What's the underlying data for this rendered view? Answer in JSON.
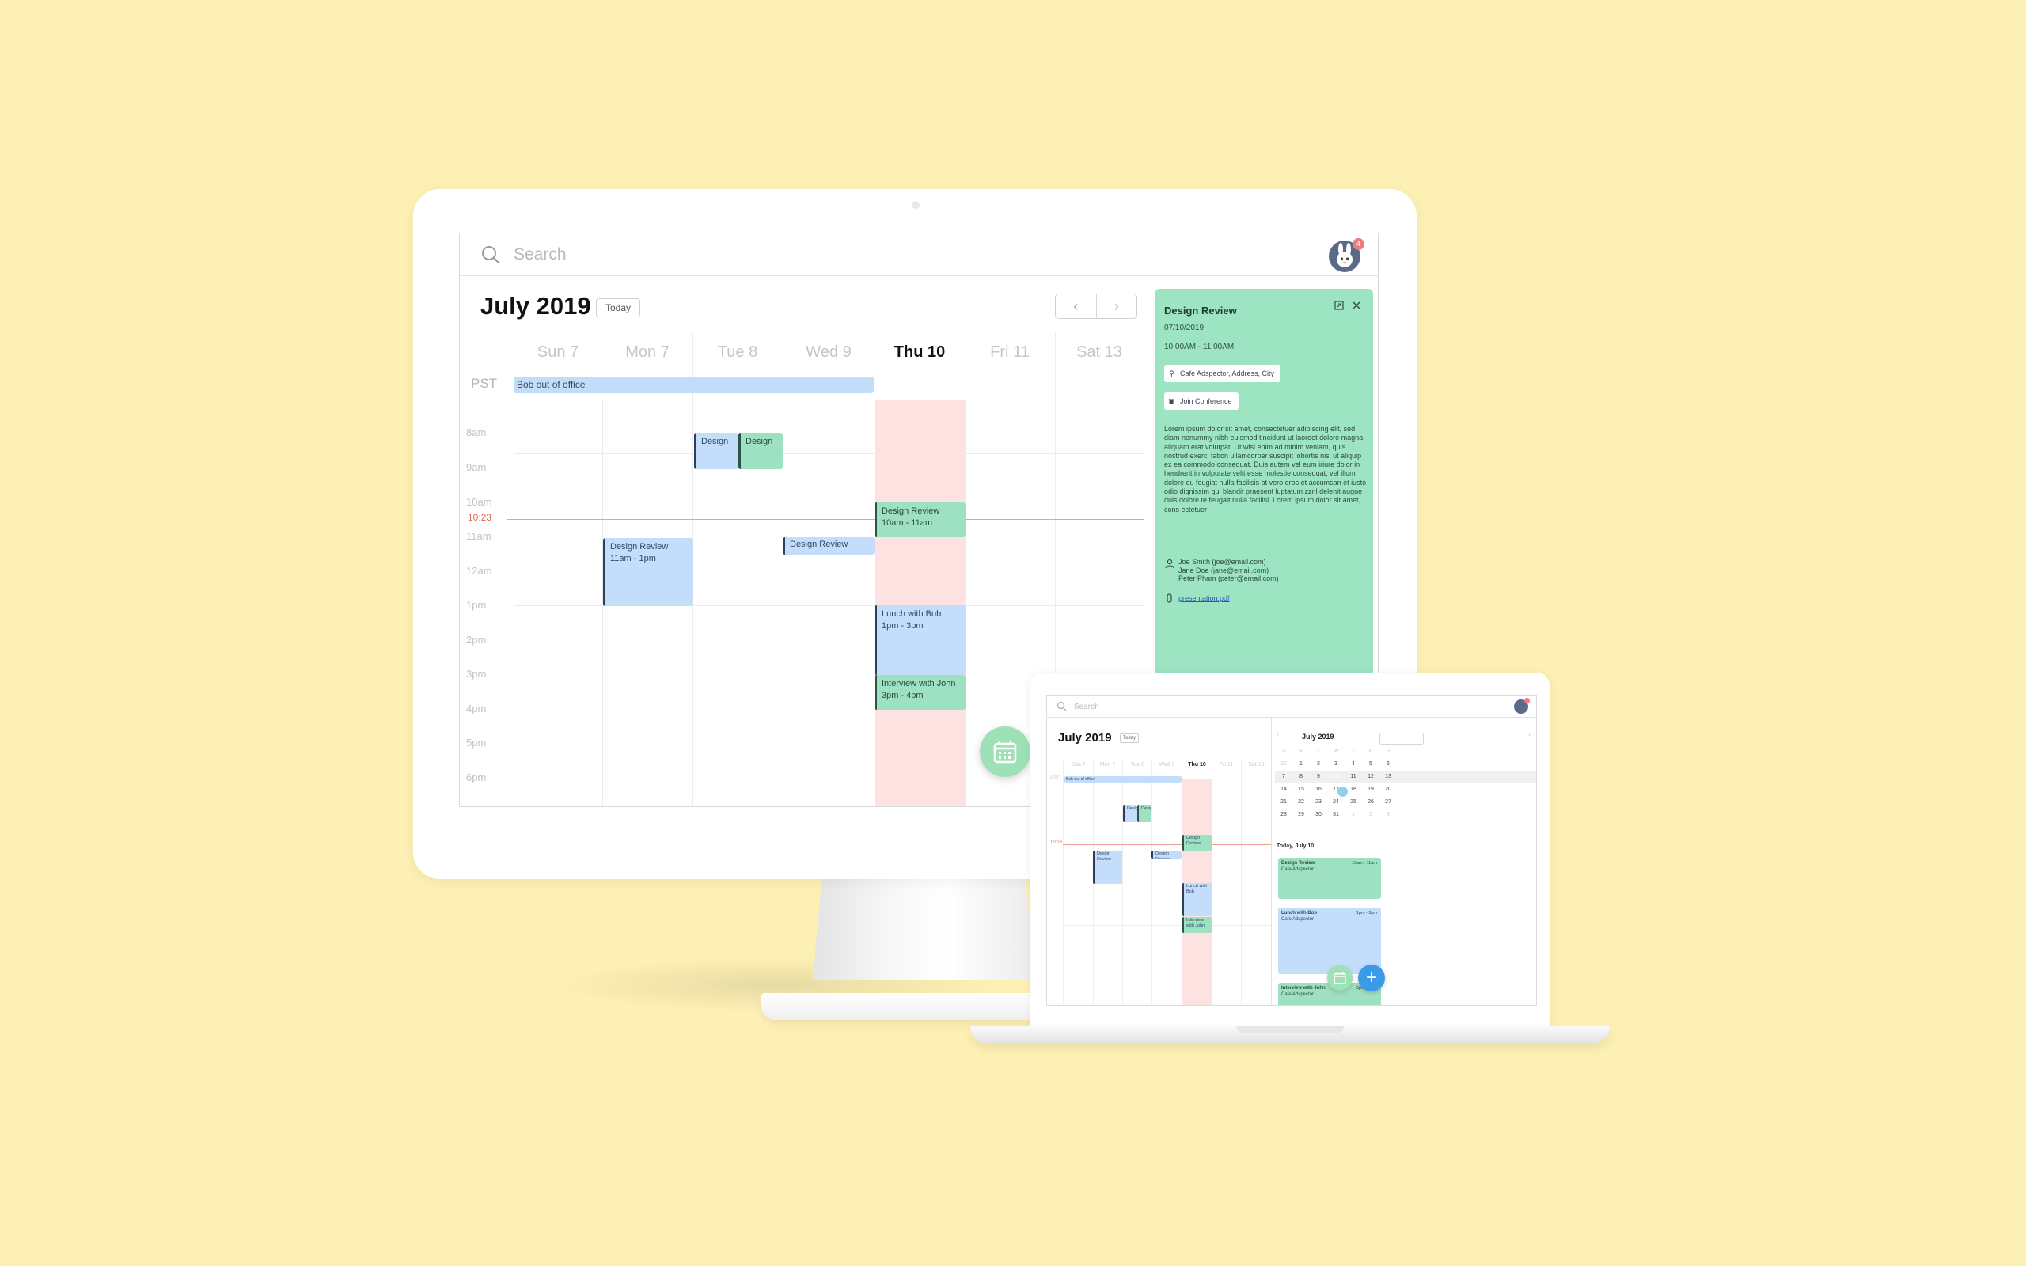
{
  "desktop": {
    "search": {
      "placeholder": "Search"
    },
    "avatar_badge": "4",
    "month_title": "July 2019",
    "today_label": "Today",
    "timezone": "PST",
    "days": [
      "Sun 7",
      "Mon 7",
      "Tue 8",
      "Wed 9",
      "Thu 10",
      "Fri 11",
      "Sat 13"
    ],
    "hours": [
      "8am",
      "9am",
      "10am",
      "11am",
      "12am",
      "1pm",
      "2pm",
      "3pm",
      "4pm",
      "5pm",
      "6pm"
    ],
    "now_label": "10:23",
    "all_day_event": "Bob out of office",
    "events": {
      "design_tue": "Design",
      "design_wed": "Design",
      "design_review_thu": {
        "title": "Design Review",
        "time": "10am - 11am"
      },
      "design_review_mon": {
        "title": "Design Review",
        "time": "11am - 1pm"
      },
      "design_review_wed": {
        "title": "Design Review"
      },
      "lunch": {
        "title": "Lunch with Bob",
        "time": "1pm - 3pm"
      },
      "interview": {
        "title": "Interview with John",
        "time": "3pm - 4pm"
      }
    },
    "detail": {
      "title": "Design Review",
      "date": "07/10/2019",
      "time": "10:00AM - 11:00AM",
      "location": "Cafe Adspector, Address, City",
      "conference": "Join Conference",
      "body": "Lorem ipsum dolor sit amet, consectetuer adipiscing elit, sed diam nonummy nibh euismod tincidunt ut laoreet dolore magna aliquam erat volutpat. Ut wisi enim ad minim veniam, quis nostrud exerci tation ullamcorper suscipit lobortis nisl ut aliquip ex ea commodo consequat. Duis autem vel eum iriure dolor in hendrerit in vulputate velit esse molestie consequat, vel illum dolore eu feugiat nulla facilisis at vero eros et accumsan et iusto odio dignissim qui blandit praesent luptatum zzril delenit augue duis dolore te feugait nulla facilisi. Lorem ipsum dolor sit amet, cons ectetuer",
      "people": [
        "Joe Smith (joe@email.com)",
        "Jane Doe (jane@email.com)",
        "Peter Pham (peter@email.com)"
      ],
      "attachment": "presentation.pdf"
    }
  },
  "laptop": {
    "search": {
      "placeholder": "Search"
    },
    "month_title": "July 2019",
    "today_label": "Today",
    "mini_title": "July 2019",
    "mini_days": [
      "S",
      "M",
      "T",
      "W",
      "T",
      "F",
      "S"
    ],
    "mini_weeks": [
      [
        "30",
        "1",
        "2",
        "3",
        "4",
        "5",
        "6"
      ],
      [
        "7",
        "8",
        "9",
        "10",
        "11",
        "12",
        "13"
      ],
      [
        "14",
        "15",
        "16",
        "17",
        "18",
        "19",
        "20"
      ],
      [
        "21",
        "22",
        "23",
        "24",
        "25",
        "26",
        "27"
      ],
      [
        "28",
        "29",
        "30",
        "31",
        "1",
        "2",
        "3"
      ]
    ],
    "today_heading": "Today, July 10",
    "cards": [
      {
        "title": "Design Review",
        "time": "10am - 11am",
        "place": "Cafe Adspector"
      },
      {
        "title": "Lunch with Bob",
        "time": "1pm - 3pm",
        "place": "Cafe Adspector"
      },
      {
        "title": "Interview with John",
        "time": "3pm - 4pm",
        "place": "Cafe Adspector"
      }
    ]
  },
  "colors": {
    "background": "#fdf0b4",
    "event_blue": "#c3ddfb",
    "event_green": "#9ee1c2",
    "today_column": "#fce2e0",
    "fab_blue": "#3c9be8"
  }
}
